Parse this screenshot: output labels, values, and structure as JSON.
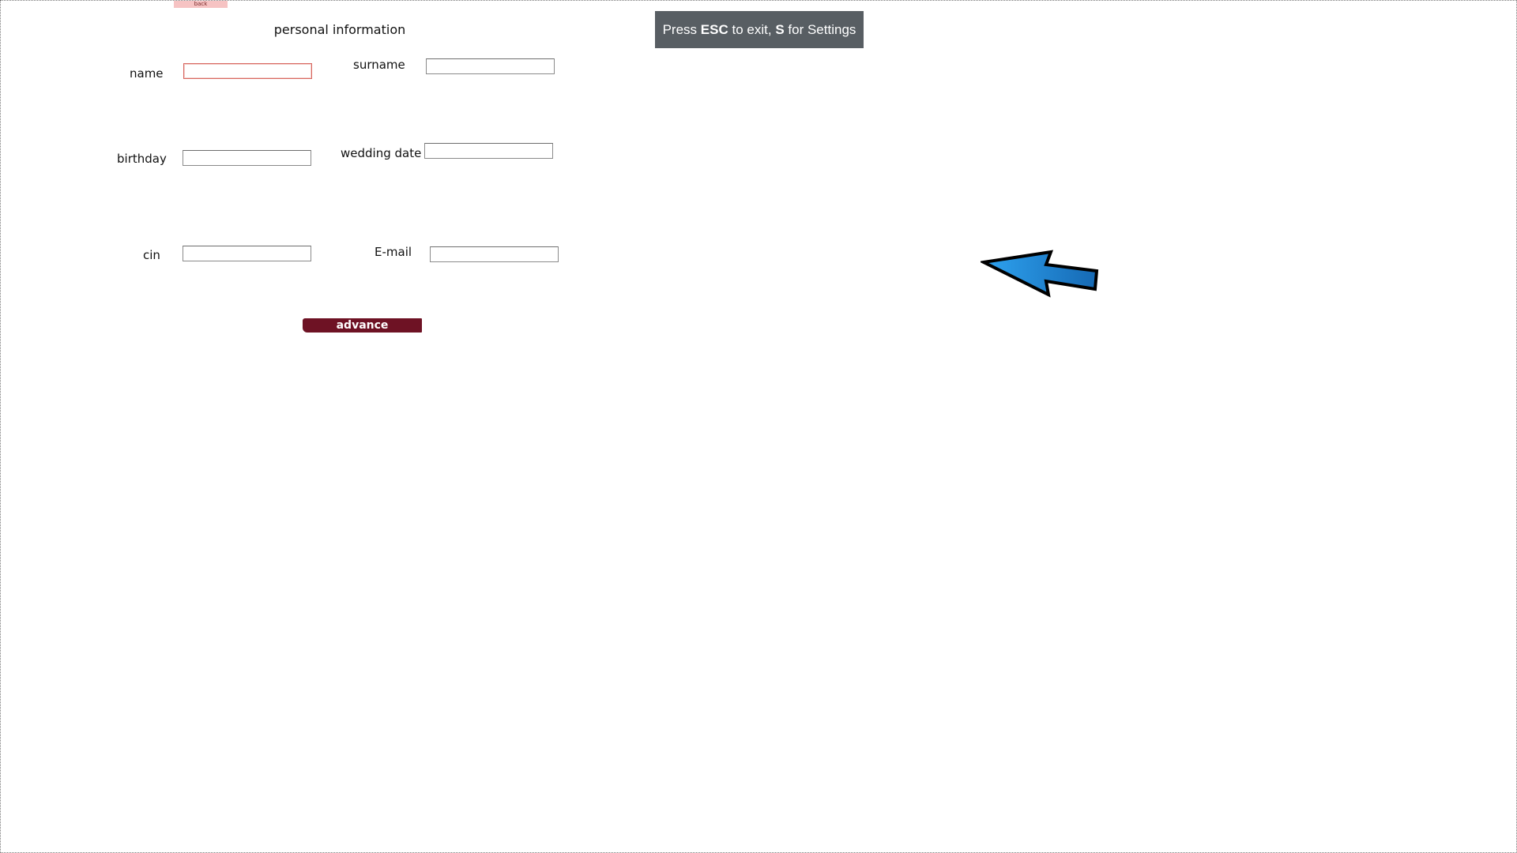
{
  "back_button": {
    "label": "back"
  },
  "form": {
    "title": "personal information",
    "fields": {
      "name": {
        "label": "name",
        "value": "",
        "placeholder": ""
      },
      "surname": {
        "label": "surname",
        "value": "",
        "placeholder": ""
      },
      "birthday": {
        "label": "birthday",
        "value": "",
        "placeholder": ""
      },
      "wedding_date": {
        "label": "wedding date",
        "value": "",
        "placeholder": ""
      },
      "cin": {
        "label": "cin",
        "value": "",
        "placeholder": ""
      },
      "email": {
        "label": "E-mail",
        "value": "",
        "placeholder": ""
      }
    },
    "advance_label": "advance"
  },
  "esc_banner": {
    "press": "Press",
    "esc_key": "ESC",
    "to_exit": "to exit,",
    "s_key": "S",
    "for_settings": "for Settings"
  },
  "pointer": {
    "icon": "arrow-pointer-icon",
    "fill_color": "#1f8ad8",
    "stroke_color": "#000000"
  },
  "colors": {
    "advance_button": "#6e1224",
    "back_button": "#f6c3c3",
    "banner_background": "#585e63",
    "focused_field_border": "#d8665f"
  }
}
